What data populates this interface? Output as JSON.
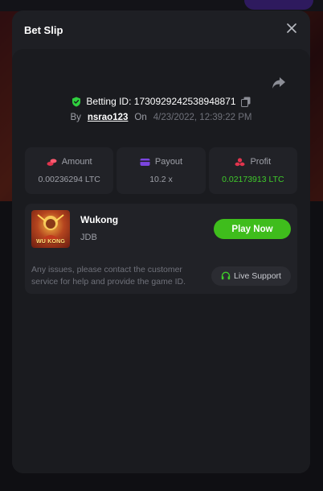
{
  "modal": {
    "title": "Bet Slip",
    "close_icon": "close-icon"
  },
  "bet": {
    "betting_id_label": "Betting ID: 1730929242538948871",
    "by_label": "By",
    "user": "nsrao123",
    "on_label": "On",
    "date": "4/23/2022, 12:39:22 PM"
  },
  "stats": {
    "amount_label": "Amount",
    "amount_value": "0.00236294 LTC",
    "payout_label": "Payout",
    "payout_value": "10.2 x",
    "profit_label": "Profit",
    "profit_value": "0.02173913 LTC"
  },
  "game": {
    "name": "Wukong",
    "provider": "JDB",
    "thumb_text": "WU KONG",
    "play_label": "Play Now"
  },
  "support": {
    "text": "Any issues, please contact the customer service for help and provide the game ID.",
    "button_label": "Live Support"
  },
  "colors": {
    "accent_green": "#3fbd1c",
    "profit_green": "#3fcb2b",
    "amount_icon": "#e0344d",
    "payout_icon": "#7b45e0",
    "profit_icon": "#e0344d",
    "shield": "#2fcf3e"
  },
  "icons": [
    "close-icon",
    "share-icon",
    "shield-check-icon",
    "copy-icon",
    "coins-icon",
    "wallet-icon",
    "profit-icon",
    "headset-icon"
  ]
}
